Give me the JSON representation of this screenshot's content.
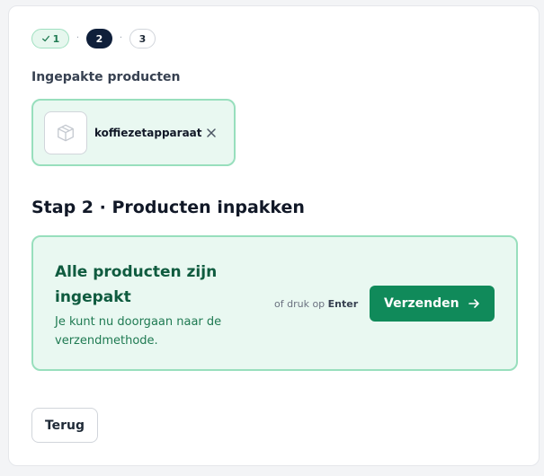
{
  "stepper": {
    "steps": [
      {
        "label": "1",
        "state": "done"
      },
      {
        "label": "2",
        "state": "current"
      },
      {
        "label": "3",
        "state": "todo"
      }
    ],
    "separator": "·"
  },
  "packed": {
    "label": "Ingepakte producten",
    "items": [
      {
        "name": "koffiezetapparaat",
        "icon": "package-icon"
      }
    ]
  },
  "step_title": "Stap 2 · Producten inpakken",
  "done_panel": {
    "title": "Alle producten zijn ingepakt",
    "subtitle": "Je kunt nu doorgaan naar de verzendmethode.",
    "hint_prefix": "of druk op",
    "hint_key": "Enter",
    "send_label": "Verzenden"
  },
  "back_label": "Terug",
  "colors": {
    "accent": "#108a5a",
    "success_bg": "#e9f8f1",
    "success_border": "#98dfbd",
    "step_current": "#0f1f3a"
  }
}
